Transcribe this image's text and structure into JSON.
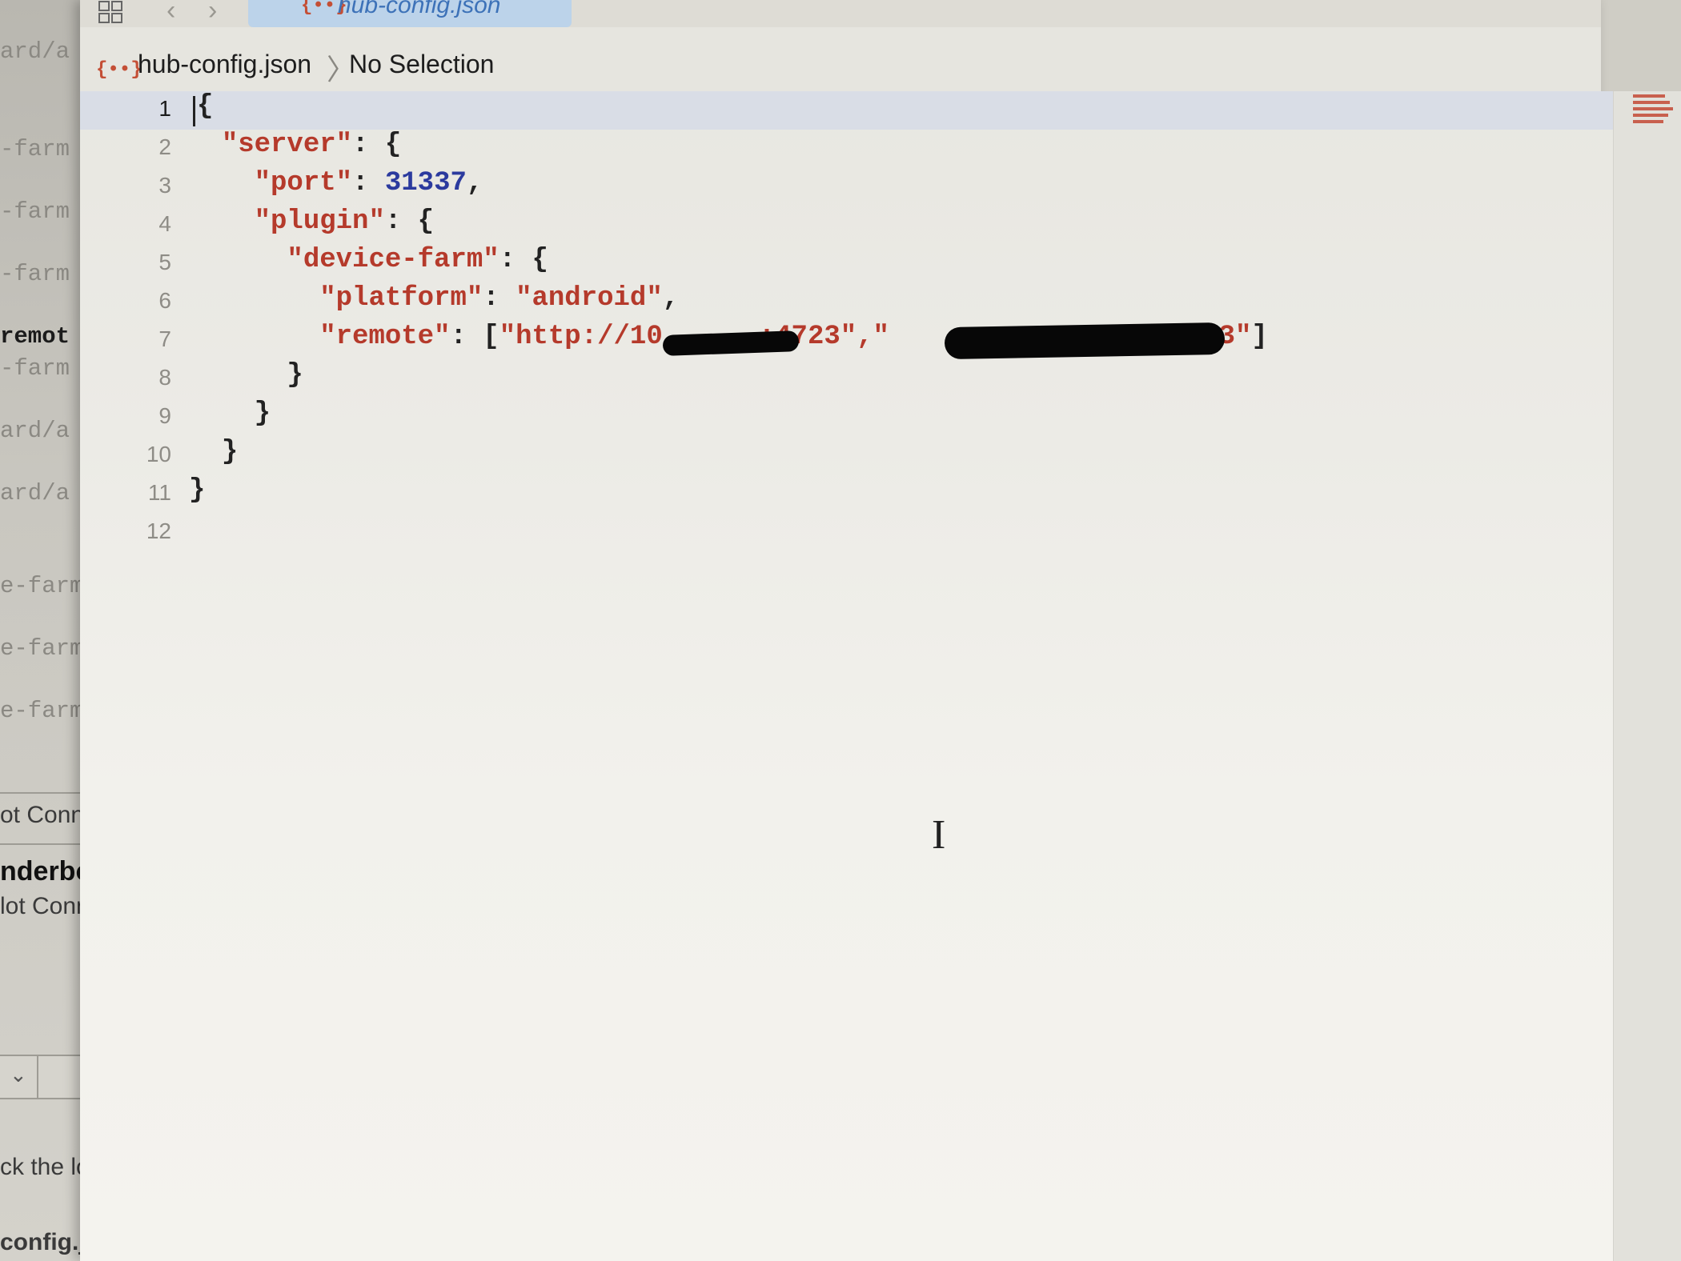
{
  "background_terminal": {
    "lines": [
      {
        "text": "ard/a"
      },
      {
        "text": "-farm"
      },
      {
        "text": "-farm"
      },
      {
        "text": "-farm"
      },
      {
        "text": " remot"
      },
      {
        "text": "-farm"
      },
      {
        "text": "ard/a"
      },
      {
        "text": "ard/a"
      },
      {
        "text": "e-farm"
      },
      {
        "text": "e-farm"
      },
      {
        "text": "e-farm"
      }
    ],
    "panel": {
      "status1": "ot Conne",
      "device": "nderbol",
      "status2": "lot Conne",
      "hint": "ck the loc",
      "file": "config.jso"
    }
  },
  "toolbar": {
    "tab_icon": "{••}",
    "tab_label": "hub-config.json"
  },
  "jumpbar": {
    "file_icon": "{••}",
    "file": "hub-config.json",
    "separator": "〉",
    "selection": "No Selection"
  },
  "editor": {
    "line_numbers": [
      "1",
      "2",
      "3",
      "4",
      "5",
      "6",
      "7",
      "8",
      "9",
      "10",
      "11",
      "12"
    ],
    "code": {
      "l1": "{",
      "l2_key": "\"server\"",
      "l2_rest": ": {",
      "l3_key": "\"port\"",
      "l3_sep": ": ",
      "l3_val": "31337",
      "l3_end": ",",
      "l4_key": "\"plugin\"",
      "l4_rest": ": {",
      "l5_key": "\"device-farm\"",
      "l5_rest": ": {",
      "l6_key": "\"platform\"",
      "l6_sep": ": ",
      "l6_val": "\"android\"",
      "l6_end": ",",
      "l7_key": "\"remote\"",
      "l7_sep": ": [",
      "l7_a": "\"http://10",
      "l7_b": ":4723\"",
      "l7_c": ",\"",
      "l7_d": ":4723\"",
      "l7_end": "]",
      "l8": "}",
      "l9": "}",
      "l10": "}",
      "l11": "}"
    },
    "cursor_glyph": "I"
  },
  "colors": {
    "key_string": "#b53a2b",
    "number": "#2b3a9e",
    "current_line": "#d9dde6",
    "tab_active": "#bcd3ea"
  }
}
